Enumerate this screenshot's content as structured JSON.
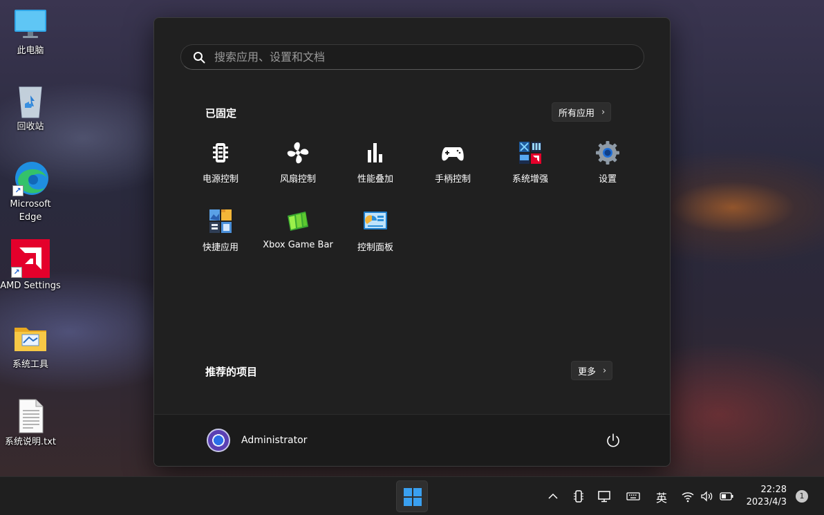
{
  "desktop": {
    "icons": [
      {
        "label": "此电脑",
        "icon": "computer-icon"
      },
      {
        "label": "回收站",
        "icon": "recycle-bin-icon"
      },
      {
        "label": "Microsoft Edge",
        "icon": "edge-icon"
      },
      {
        "label": "AMD Settings",
        "icon": "amd-icon"
      },
      {
        "label": "系统工具",
        "icon": "folder-icon"
      },
      {
        "label": "系统说明.txt",
        "icon": "text-file-icon"
      }
    ]
  },
  "start_menu": {
    "search": {
      "placeholder": "搜索应用、设置和文档"
    },
    "pinned": {
      "title": "已固定",
      "all_apps_label": "所有应用",
      "apps": [
        {
          "label": "电源控制",
          "icon": "power-control-icon"
        },
        {
          "label": "风扇控制",
          "icon": "fan-icon"
        },
        {
          "label": "性能叠加",
          "icon": "performance-bars-icon"
        },
        {
          "label": "手柄控制",
          "icon": "gamepad-icon"
        },
        {
          "label": "系统增强",
          "icon": "system-enhance-icon"
        },
        {
          "label": "设置",
          "icon": "settings-gear-icon"
        },
        {
          "label": "快捷应用",
          "icon": "quick-apps-icon"
        },
        {
          "label": "Xbox Game Bar",
          "icon": "xbox-game-bar-icon"
        },
        {
          "label": "控制面板",
          "icon": "control-panel-icon"
        }
      ]
    },
    "recommended": {
      "title": "推荐的项目",
      "more_label": "更多"
    },
    "user": {
      "name": "Administrator"
    }
  },
  "taskbar": {
    "tray": {
      "input_method": "英"
    },
    "clock": {
      "time": "22:28",
      "date": "2023/4/3"
    },
    "notification_count": "1"
  },
  "colors": {
    "menu_bg": "#202020",
    "taskbar_bg": "#1f1f1f",
    "accent_blue": "#3aa0f0"
  }
}
